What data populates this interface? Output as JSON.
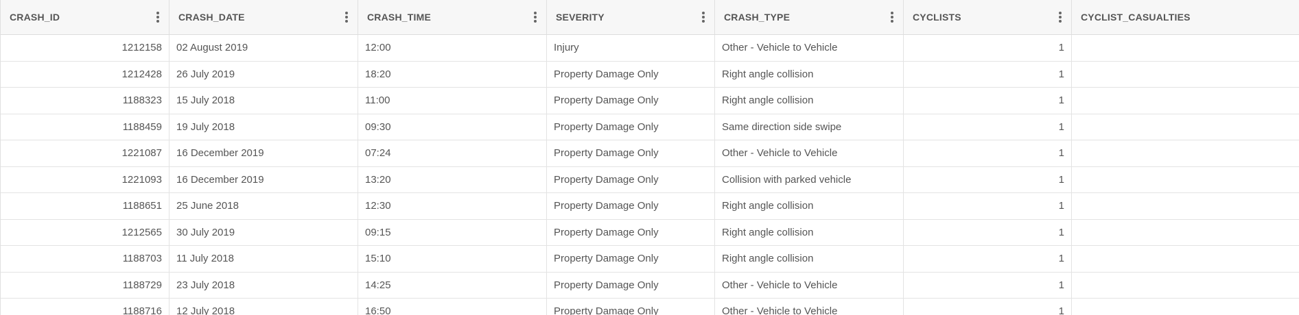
{
  "columns": [
    {
      "label": "CRASH_ID",
      "menu": true
    },
    {
      "label": "CRASH_DATE",
      "menu": true
    },
    {
      "label": "CRASH_TIME",
      "menu": true
    },
    {
      "label": "SEVERITY",
      "menu": true
    },
    {
      "label": "CRASH_TYPE",
      "menu": true
    },
    {
      "label": "CYCLISTS",
      "menu": true
    },
    {
      "label": "CYCLIST_CASUALTIES",
      "menu": false
    }
  ],
  "rows": [
    {
      "crash_id": "1212158",
      "crash_date": "02 August 2019",
      "crash_time": "12:00",
      "severity": "Injury",
      "crash_type": "Other - Vehicle to Vehicle",
      "cyclists": "1",
      "cyclist_casualties": ""
    },
    {
      "crash_id": "1212428",
      "crash_date": "26 July 2019",
      "crash_time": "18:20",
      "severity": "Property Damage Only",
      "crash_type": "Right angle collision",
      "cyclists": "1",
      "cyclist_casualties": ""
    },
    {
      "crash_id": "1188323",
      "crash_date": "15 July 2018",
      "crash_time": "11:00",
      "severity": "Property Damage Only",
      "crash_type": "Right angle collision",
      "cyclists": "1",
      "cyclist_casualties": ""
    },
    {
      "crash_id": "1188459",
      "crash_date": "19 July 2018",
      "crash_time": "09:30",
      "severity": "Property Damage Only",
      "crash_type": "Same direction side swipe",
      "cyclists": "1",
      "cyclist_casualties": ""
    },
    {
      "crash_id": "1221087",
      "crash_date": "16 December 2019",
      "crash_time": "07:24",
      "severity": "Property Damage Only",
      "crash_type": "Other - Vehicle to Vehicle",
      "cyclists": "1",
      "cyclist_casualties": ""
    },
    {
      "crash_id": "1221093",
      "crash_date": "16 December 2019",
      "crash_time": "13:20",
      "severity": "Property Damage Only",
      "crash_type": "Collision with parked vehicle",
      "cyclists": "1",
      "cyclist_casualties": ""
    },
    {
      "crash_id": "1188651",
      "crash_date": "25 June 2018",
      "crash_time": "12:30",
      "severity": "Property Damage Only",
      "crash_type": "Right angle collision",
      "cyclists": "1",
      "cyclist_casualties": ""
    },
    {
      "crash_id": "1212565",
      "crash_date": "30 July 2019",
      "crash_time": "09:15",
      "severity": "Property Damage Only",
      "crash_type": "Right angle collision",
      "cyclists": "1",
      "cyclist_casualties": ""
    },
    {
      "crash_id": "1188703",
      "crash_date": "11 July 2018",
      "crash_time": "15:10",
      "severity": "Property Damage Only",
      "crash_type": "Right angle collision",
      "cyclists": "1",
      "cyclist_casualties": ""
    },
    {
      "crash_id": "1188729",
      "crash_date": "23 July 2018",
      "crash_time": "14:25",
      "severity": "Property Damage Only",
      "crash_type": "Other - Vehicle to Vehicle",
      "cyclists": "1",
      "cyclist_casualties": ""
    },
    {
      "crash_id": "1188716",
      "crash_date": "12 July 2018",
      "crash_time": "16:50",
      "severity": "Property Damage Only",
      "crash_type": "Other - Vehicle to Vehicle",
      "cyclists": "1",
      "cyclist_casualties": ""
    }
  ]
}
